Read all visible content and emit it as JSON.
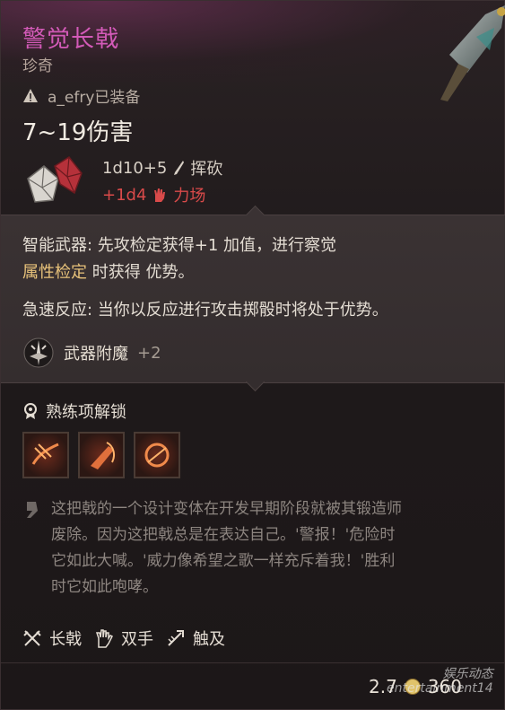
{
  "item": {
    "name": "警觉长戟",
    "rarity": "珍奇",
    "equipped_by": "a_efry已装备",
    "damage_range": "7~19伤害",
    "damage_main": "1d10+5",
    "damage_main_type": "挥砍",
    "damage_bonus": "+1d4",
    "damage_bonus_type": "力场"
  },
  "abilities": [
    {
      "name": "智能武器:",
      "line1": " 先攻检定获得+1 加值，进行察觉",
      "line2_hl": "属性检定",
      "line2": " 时获得 优势。"
    },
    {
      "name": "急速反应:",
      "line1": " 当你以反应进行攻击掷骰时将处于优势。"
    }
  ],
  "enchantment": {
    "label": "武器附魔",
    "value": "+2"
  },
  "proficiency": {
    "label": "熟练项解锁"
  },
  "description": [
    "这把戟的一个设计变体在开发早期阶段就被其锻造师",
    "废除。因为这把戟总是在表达自己。'警报！'危险时",
    "它如此大喊。'威力像希望之歌一样充斥着我！'胜利",
    "时它如此咆哮。"
  ],
  "tags": [
    "长戟",
    "双手",
    "触及"
  ],
  "footer": {
    "weight": "2.7",
    "price": "360"
  },
  "watermark": {
    "line1": "娱乐动态",
    "line2": "entertainment14"
  },
  "colors": {
    "title": "#d35ab8",
    "bonus": "#d94a4a",
    "highlight": "#e8c27a"
  },
  "icons": [
    "warning-icon",
    "dice-icon",
    "sword-icon",
    "hand-icon",
    "enchant-icon",
    "badge-icon",
    "quote-icon",
    "halberd-icon",
    "two-hand-icon",
    "reach-icon",
    "coin-icon"
  ]
}
